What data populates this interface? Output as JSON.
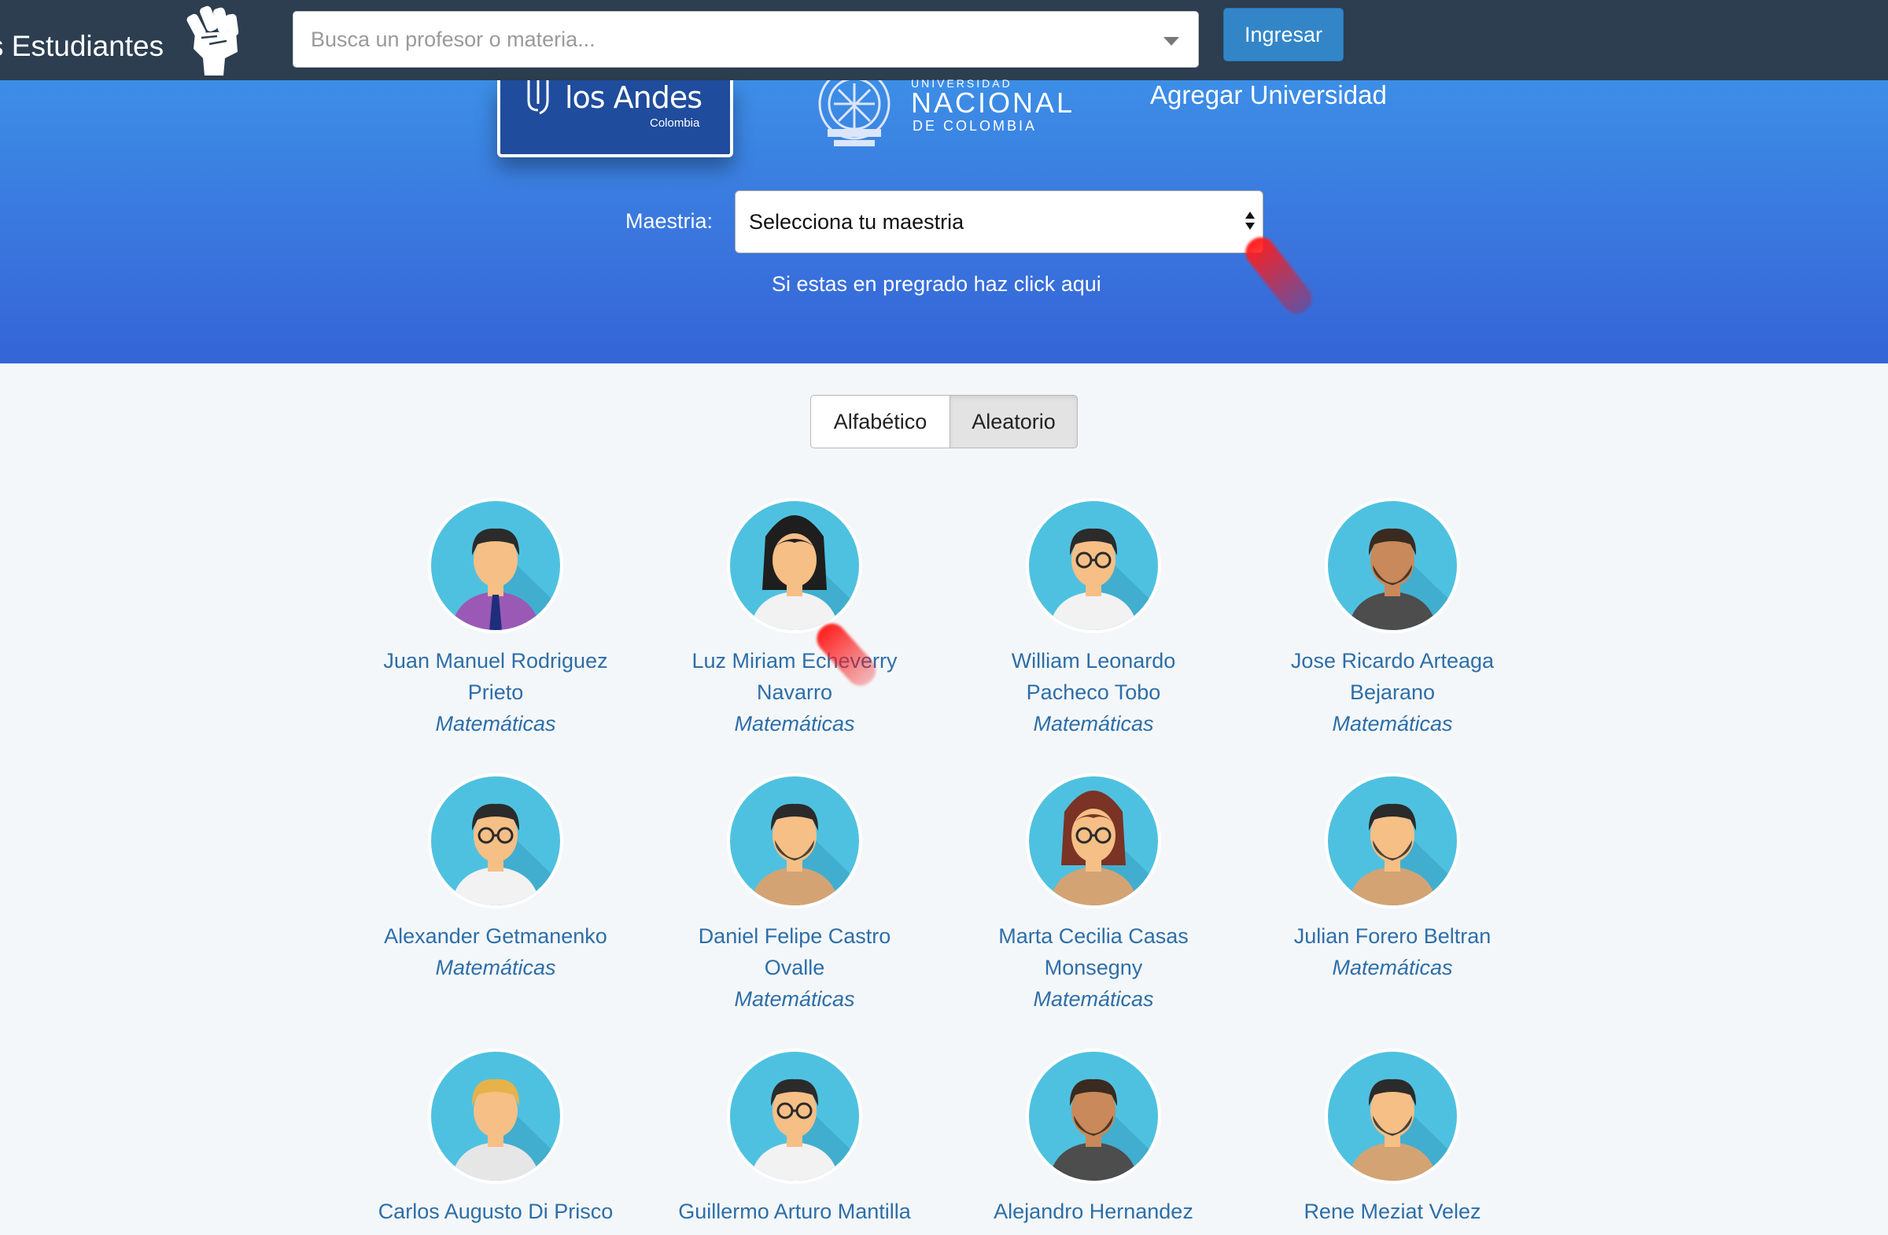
{
  "header": {
    "brand": "s Estudiantes",
    "search_placeholder": "Busca un profesor o materia...",
    "login_label": "Ingresar"
  },
  "universities": {
    "andes": {
      "name": "los Andes",
      "sub": "Colombia"
    },
    "nacional": {
      "top": "UNIVERSIDAD",
      "name": "NACIONAL",
      "sub": "DE COLOMBIA"
    },
    "add_label": "Agregar Universidad"
  },
  "filter": {
    "maestria_label": "Maestria:",
    "maestria_value": "Selecciona tu maestria",
    "pregrado_link": "Si estas en pregrado haz click aqui"
  },
  "sort": {
    "alpha_label": "Alfabético",
    "random_label": "Aleatorio",
    "active": "Aleatorio"
  },
  "professors": [
    {
      "name_line1": "Juan Manuel Rodriguez",
      "name_line2": "Prieto",
      "subject": "Matemáticas",
      "avatar": "man-purple-shirt-tie",
      "colors": {
        "hair": "#2b2b2b",
        "skin": "#f6bf86",
        "shirt": "#9b59b6",
        "tie": "#1f2e7a"
      }
    },
    {
      "name_line1": "Luz Miriam Echeverry",
      "name_line2": "Navarro",
      "subject": "Matemáticas",
      "avatar": "woman-white-blouse",
      "colors": {
        "hair": "#1e1e1e",
        "skin": "#f6bf86",
        "shirt": "#f2f2f2"
      }
    },
    {
      "name_line1": "William Leonardo",
      "name_line2": "Pacheco Tobo",
      "subject": "Matemáticas",
      "avatar": "man-glasses-white-shirt",
      "colors": {
        "hair": "#2b2b2b",
        "skin": "#f6bf86",
        "shirt": "#f2f2f2"
      }
    },
    {
      "name_line1": "Jose Ricardo Arteaga",
      "name_line2": "Bejarano",
      "subject": "Matemáticas",
      "avatar": "man-beard-dark-shirt",
      "colors": {
        "hair": "#3a2a20",
        "skin": "#c9895a",
        "shirt": "#4d4d4d"
      }
    },
    {
      "name_line1": "Alexander Getmanenko",
      "name_line2": "",
      "subject": "Matemáticas",
      "avatar": "man-glasses-white-shirt",
      "colors": {
        "hair": "#2b2b2b",
        "skin": "#f6bf86",
        "shirt": "#f2f2f2"
      }
    },
    {
      "name_line1": "Daniel Felipe Castro",
      "name_line2": "Ovalle",
      "subject": "Matemáticas",
      "avatar": "man-tan-jacket",
      "colors": {
        "hair": "#2b2b2b",
        "skin": "#f6bf86",
        "shirt": "#d4a373"
      }
    },
    {
      "name_line1": "Marta Cecilia Casas",
      "name_line2": "Monsegny",
      "subject": "Matemáticas",
      "avatar": "woman-glasses-tan",
      "colors": {
        "hair": "#7a3324",
        "skin": "#f6bf86",
        "shirt": "#d4a373"
      }
    },
    {
      "name_line1": "Julian Forero Beltran",
      "name_line2": "",
      "subject": "Matemáticas",
      "avatar": "man-tan-jacket",
      "colors": {
        "hair": "#2b2b2b",
        "skin": "#f6bf86",
        "shirt": "#d4a373"
      }
    },
    {
      "name_line1": "Carlos Augusto Di Prisco",
      "name_line2": "",
      "subject": "",
      "avatar": "man-blond-checkered",
      "colors": {
        "hair": "#e8b24a",
        "skin": "#f6bf86",
        "shirt": "#e6e6e6"
      }
    },
    {
      "name_line1": "Guillermo Arturo Mantilla",
      "name_line2": "",
      "subject": "",
      "avatar": "man-glasses-white-shirt",
      "colors": {
        "hair": "#2b2b2b",
        "skin": "#f6bf86",
        "shirt": "#f2f2f2"
      }
    },
    {
      "name_line1": "Alejandro Hernandez",
      "name_line2": "",
      "subject": "",
      "avatar": "man-beard-dark-shirt",
      "colors": {
        "hair": "#3a2a20",
        "skin": "#c9895a",
        "shirt": "#4d4d4d"
      }
    },
    {
      "name_line1": "Rene Meziat Velez",
      "name_line2": "",
      "subject": "",
      "avatar": "man-tan-jacket",
      "colors": {
        "hair": "#2b2b2b",
        "skin": "#f6bf86",
        "shirt": "#d4a373"
      }
    }
  ],
  "colors": {
    "topbar": "#2c3e50",
    "hero": "#3a76de",
    "link": "#2d6ea8",
    "avatar_bg": "#4fc1e0",
    "button": "#3286c8"
  }
}
